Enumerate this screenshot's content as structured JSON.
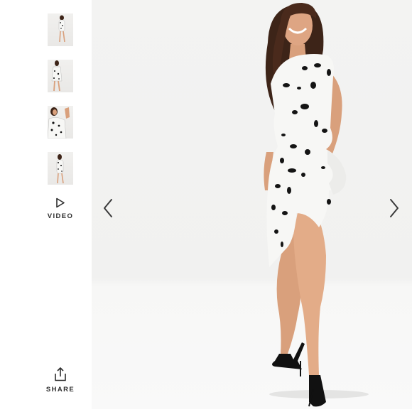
{
  "gallery": {
    "thumbnails": [
      {
        "alt": "front-view"
      },
      {
        "alt": "back-view"
      },
      {
        "alt": "detail-view"
      },
      {
        "alt": "full-length-view"
      }
    ],
    "video_label": "VIDEO",
    "share_label": "SHARE"
  },
  "colors": {
    "text": "#2d2d2d",
    "stage_bg": "#f1f1f0",
    "dress": "#f7f7f5",
    "spots": "#141414",
    "skin": "#d9a07c",
    "hair": "#3d2418"
  },
  "icons": {
    "prev": "chevron-left-icon",
    "next": "chevron-right-icon",
    "video": "play-icon",
    "share": "share-icon"
  }
}
